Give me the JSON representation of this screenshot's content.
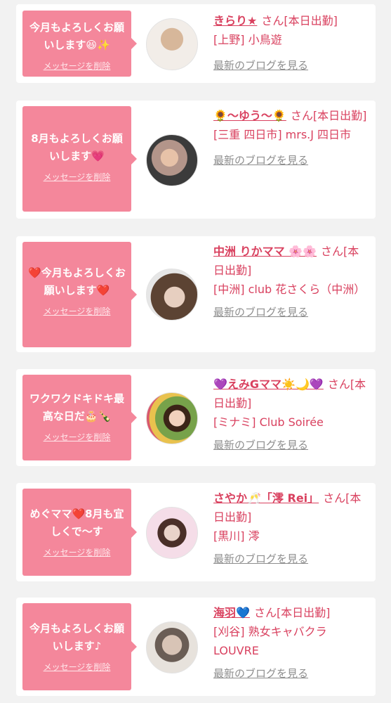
{
  "entries": [
    {
      "message": "今月もよろしくお願いします😆✨",
      "delete_label": "メッセージを削除",
      "avatar_icon": "profile-photo",
      "name": "きらり★",
      "suffix": "さん[本日出勤]",
      "location": "[上野] 小鳥遊",
      "blog_link": "最新のブログを見る"
    },
    {
      "message": "8月もよろしくお願いします💗",
      "delete_label": "メッセージを削除",
      "avatar_icon": "profile-photo",
      "name": "🌻〜ゆう〜🌻",
      "suffix": "さん[本日出勤]",
      "location": "[三重 四日市] mrs.J 四日市",
      "blog_link": "最新のブログを見る"
    },
    {
      "message": "❤️今月もよろしくお願いします❤️",
      "delete_label": "メッセージを削除",
      "avatar_icon": "profile-photo",
      "name": "中洲 りかママ 🌸🌸",
      "suffix": "さん[本日出勤]",
      "location": "[中洲] club 花さくら（中洲）",
      "blog_link": "最新のブログを見る"
    },
    {
      "message": "ワクワクドキドキ最高な日だ🎂🍾",
      "delete_label": "メッセージを削除",
      "avatar_icon": "profile-photo",
      "name": "💜えみGママ☀️🌙💜",
      "suffix": "さん[本日出勤]",
      "location": "[ミナミ] Club Soirée",
      "blog_link": "最新のブログを見る"
    },
    {
      "message": "めぐママ❤️8月も宜しくで〜す",
      "delete_label": "メッセージを削除",
      "avatar_icon": "profile-photo",
      "name": "さやか🥂「澪 Rei」",
      "suffix": "さん[本日出勤]",
      "location": "[黒川] 澪",
      "blog_link": "最新のブログを見る"
    },
    {
      "message": "今月もよろしくお願いします♪",
      "delete_label": "メッセージを削除",
      "avatar_icon": "profile-photo",
      "name": "海羽💙",
      "suffix": "さん[本日出勤]",
      "location": "[刈谷] 熟女キャバクラ LOUVRE",
      "blog_link": "最新のブログを見る"
    }
  ],
  "colors": {
    "bubble": "#f4879b",
    "name_text": "#d9415f",
    "blog_link": "#8e8e8e",
    "card": "#ffffff",
    "page_bg": "#f2f2f2"
  }
}
